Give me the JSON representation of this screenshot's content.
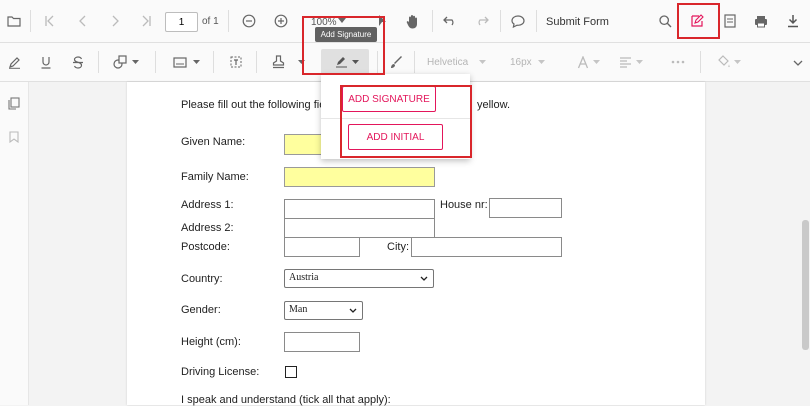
{
  "toolbar": {
    "page_current": "1",
    "page_of": "of 1",
    "zoom": "100%",
    "submit_form": "Submit Form",
    "font_name": "Helvetica",
    "font_size": "16px"
  },
  "tooltip": "Add Signature",
  "signature_menu": {
    "add_signature": "ADD SIGNATURE",
    "add_initial": "ADD INITIAL"
  },
  "form": {
    "intro_left": "Please fill out the following fie",
    "intro_right": "yellow.",
    "given_name": "Given Name:",
    "family_name": "Family Name:",
    "address1": "Address 1:",
    "house_nr": "House nr:",
    "address2": "Address 2:",
    "postcode": "Postcode:",
    "city": "City:",
    "country": "Country:",
    "country_value": "Austria",
    "gender": "Gender:",
    "gender_value": "Man",
    "height": "Height (cm):",
    "driving_license": "Driving License:",
    "languages": "I speak and understand (tick all that apply):"
  },
  "colors": {
    "highlight_red": "#d9262b",
    "accent_pink": "#e3165b",
    "field_yellow": "#ffff9e"
  }
}
